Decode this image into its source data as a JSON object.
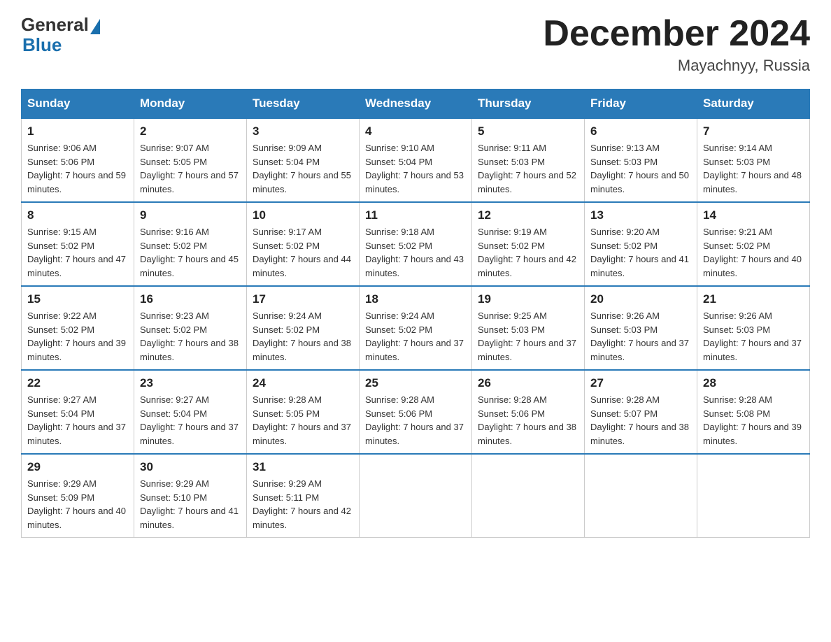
{
  "logo": {
    "general_text": "General",
    "blue_text": "Blue"
  },
  "title": {
    "month_year": "December 2024",
    "location": "Mayachnyy, Russia"
  },
  "days_of_week": [
    "Sunday",
    "Monday",
    "Tuesday",
    "Wednesday",
    "Thursday",
    "Friday",
    "Saturday"
  ],
  "weeks": [
    [
      {
        "day": "1",
        "sunrise": "9:06 AM",
        "sunset": "5:06 PM",
        "daylight": "7 hours and 59 minutes."
      },
      {
        "day": "2",
        "sunrise": "9:07 AM",
        "sunset": "5:05 PM",
        "daylight": "7 hours and 57 minutes."
      },
      {
        "day": "3",
        "sunrise": "9:09 AM",
        "sunset": "5:04 PM",
        "daylight": "7 hours and 55 minutes."
      },
      {
        "day": "4",
        "sunrise": "9:10 AM",
        "sunset": "5:04 PM",
        "daylight": "7 hours and 53 minutes."
      },
      {
        "day": "5",
        "sunrise": "9:11 AM",
        "sunset": "5:03 PM",
        "daylight": "7 hours and 52 minutes."
      },
      {
        "day": "6",
        "sunrise": "9:13 AM",
        "sunset": "5:03 PM",
        "daylight": "7 hours and 50 minutes."
      },
      {
        "day": "7",
        "sunrise": "9:14 AM",
        "sunset": "5:03 PM",
        "daylight": "7 hours and 48 minutes."
      }
    ],
    [
      {
        "day": "8",
        "sunrise": "9:15 AM",
        "sunset": "5:02 PM",
        "daylight": "7 hours and 47 minutes."
      },
      {
        "day": "9",
        "sunrise": "9:16 AM",
        "sunset": "5:02 PM",
        "daylight": "7 hours and 45 minutes."
      },
      {
        "day": "10",
        "sunrise": "9:17 AM",
        "sunset": "5:02 PM",
        "daylight": "7 hours and 44 minutes."
      },
      {
        "day": "11",
        "sunrise": "9:18 AM",
        "sunset": "5:02 PM",
        "daylight": "7 hours and 43 minutes."
      },
      {
        "day": "12",
        "sunrise": "9:19 AM",
        "sunset": "5:02 PM",
        "daylight": "7 hours and 42 minutes."
      },
      {
        "day": "13",
        "sunrise": "9:20 AM",
        "sunset": "5:02 PM",
        "daylight": "7 hours and 41 minutes."
      },
      {
        "day": "14",
        "sunrise": "9:21 AM",
        "sunset": "5:02 PM",
        "daylight": "7 hours and 40 minutes."
      }
    ],
    [
      {
        "day": "15",
        "sunrise": "9:22 AM",
        "sunset": "5:02 PM",
        "daylight": "7 hours and 39 minutes."
      },
      {
        "day": "16",
        "sunrise": "9:23 AM",
        "sunset": "5:02 PM",
        "daylight": "7 hours and 38 minutes."
      },
      {
        "day": "17",
        "sunrise": "9:24 AM",
        "sunset": "5:02 PM",
        "daylight": "7 hours and 38 minutes."
      },
      {
        "day": "18",
        "sunrise": "9:24 AM",
        "sunset": "5:02 PM",
        "daylight": "7 hours and 37 minutes."
      },
      {
        "day": "19",
        "sunrise": "9:25 AM",
        "sunset": "5:03 PM",
        "daylight": "7 hours and 37 minutes."
      },
      {
        "day": "20",
        "sunrise": "9:26 AM",
        "sunset": "5:03 PM",
        "daylight": "7 hours and 37 minutes."
      },
      {
        "day": "21",
        "sunrise": "9:26 AM",
        "sunset": "5:03 PM",
        "daylight": "7 hours and 37 minutes."
      }
    ],
    [
      {
        "day": "22",
        "sunrise": "9:27 AM",
        "sunset": "5:04 PM",
        "daylight": "7 hours and 37 minutes."
      },
      {
        "day": "23",
        "sunrise": "9:27 AM",
        "sunset": "5:04 PM",
        "daylight": "7 hours and 37 minutes."
      },
      {
        "day": "24",
        "sunrise": "9:28 AM",
        "sunset": "5:05 PM",
        "daylight": "7 hours and 37 minutes."
      },
      {
        "day": "25",
        "sunrise": "9:28 AM",
        "sunset": "5:06 PM",
        "daylight": "7 hours and 37 minutes."
      },
      {
        "day": "26",
        "sunrise": "9:28 AM",
        "sunset": "5:06 PM",
        "daylight": "7 hours and 38 minutes."
      },
      {
        "day": "27",
        "sunrise": "9:28 AM",
        "sunset": "5:07 PM",
        "daylight": "7 hours and 38 minutes."
      },
      {
        "day": "28",
        "sunrise": "9:28 AM",
        "sunset": "5:08 PM",
        "daylight": "7 hours and 39 minutes."
      }
    ],
    [
      {
        "day": "29",
        "sunrise": "9:29 AM",
        "sunset": "5:09 PM",
        "daylight": "7 hours and 40 minutes."
      },
      {
        "day": "30",
        "sunrise": "9:29 AM",
        "sunset": "5:10 PM",
        "daylight": "7 hours and 41 minutes."
      },
      {
        "day": "31",
        "sunrise": "9:29 AM",
        "sunset": "5:11 PM",
        "daylight": "7 hours and 42 minutes."
      },
      null,
      null,
      null,
      null
    ]
  ],
  "labels": {
    "sunrise_prefix": "Sunrise: ",
    "sunset_prefix": "Sunset: ",
    "daylight_prefix": "Daylight: "
  }
}
